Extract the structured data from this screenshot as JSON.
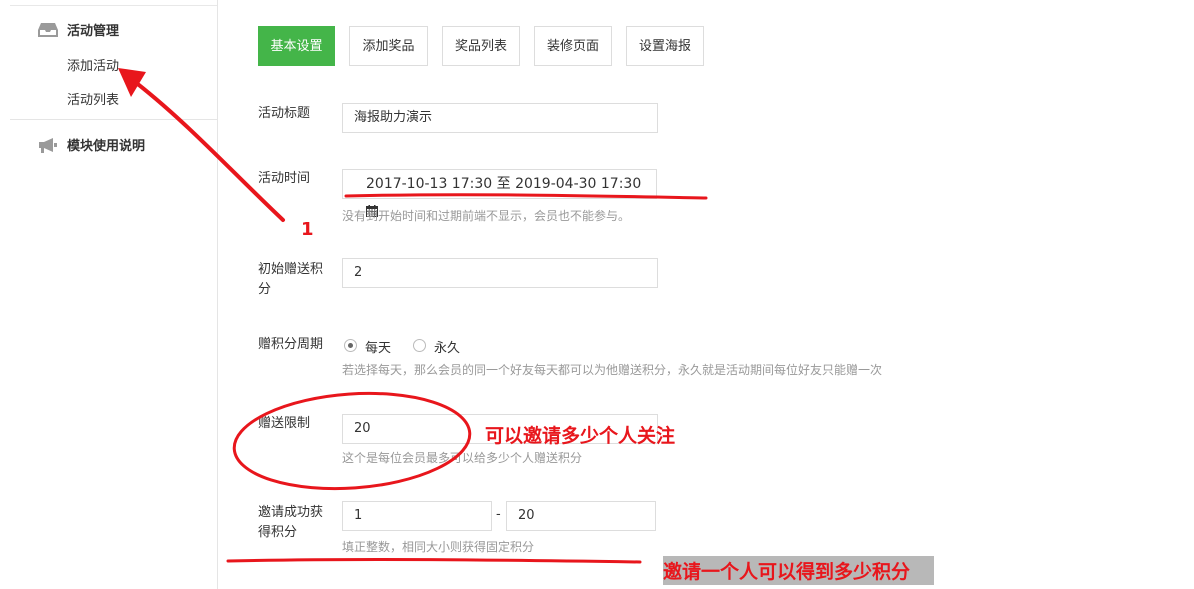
{
  "sidebar": {
    "group1": {
      "title": "活动管理",
      "icon": "inbox-icon"
    },
    "items": [
      {
        "label": "添加活动"
      },
      {
        "label": "活动列表"
      }
    ],
    "group2": {
      "title": "模块使用说明",
      "icon": "megaphone-icon"
    }
  },
  "tabs": [
    {
      "label": "基本设置",
      "active": true
    },
    {
      "label": "添加奖品",
      "active": false
    },
    {
      "label": "奖品列表",
      "active": false
    },
    {
      "label": "装修页面",
      "active": false
    },
    {
      "label": "设置海报",
      "active": false
    }
  ],
  "form": {
    "title": {
      "label": "活动标题",
      "value": "海报助力演示"
    },
    "time": {
      "label": "活动时间",
      "start": "2017-10-13 17:30",
      "sep": "至",
      "end": "2019-04-30 17:30",
      "icon": "calendar-icon",
      "help": "没有到开始时间和过期前端不显示，会员也不能参与。"
    },
    "initial_points": {
      "label_line1": "初始赠送积",
      "label_line2": "分",
      "value": "2"
    },
    "period": {
      "label": "赠积分周期",
      "options": [
        "每天",
        "永久"
      ],
      "selected": "每天",
      "help": "若选择每天，那么会员的同一个好友每天都可以为他赠送积分，永久就是活动期间每位好友只能赠一次"
    },
    "limit": {
      "label": "赠送限制",
      "value": "20",
      "help": "这个是每位会员最多可以给多少个人赠送积分"
    },
    "invite": {
      "label_line1": "邀请成功获",
      "label_line2": "得积分",
      "min": "1",
      "dash": "-",
      "max": "20",
      "help": "填正整数，相同大小则获得固定积分"
    }
  },
  "annotations": {
    "step_number": "1",
    "limit_note": "可以邀请多少个人关注",
    "invite_note": "邀请一个人可以得到多少积分",
    "color": "#e8161c"
  },
  "colors": {
    "accent": "#44b549",
    "help_text": "#999999",
    "border": "#dddddd"
  }
}
